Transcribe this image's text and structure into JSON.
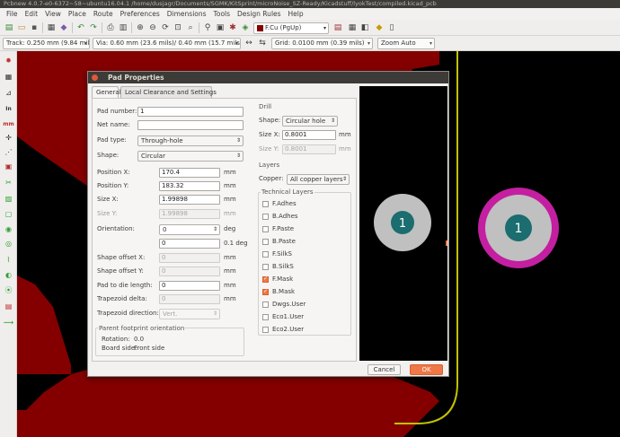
{
  "window": {
    "title": "Pcbnew 4.0.7-e0-6372~58~ubuntu16.04.1 /home/dusjagr/Documents/SGMK/KitSprint/microNoise_SZ-Ready/Kicadstuff/lyokTest/compiled.kicad_pcb"
  },
  "menubar": {
    "items": [
      "File",
      "Edit",
      "View",
      "Place",
      "Route",
      "Preferences",
      "Dimensions",
      "Tools",
      "Design Rules",
      "Help"
    ]
  },
  "toolbar": {
    "layer": "F.Cu (PgUp)",
    "track": "Track: 0.250 mm (9.84 mils) *",
    "via": "Via: 0.60 mm (23.6 mils)/ 0.40 mm (15.7 mils) *",
    "grid": "Grid: 0.0100 mm (0.39 mils)",
    "zoom": "Zoom Auto"
  },
  "dialog": {
    "title": "Pad Properties",
    "tabs": [
      "General",
      "Local Clearance and Settings"
    ],
    "general": {
      "pad_number_label": "Pad number:",
      "pad_number": "1",
      "net_name_label": "Net name:",
      "net_name": "",
      "pad_type_label": "Pad type:",
      "pad_type": "Through-hole",
      "shape_label": "Shape:",
      "shape": "Circular",
      "position_x_label": "Position X:",
      "position_x": "170.4",
      "position_y_label": "Position Y:",
      "position_y": "183.32",
      "size_x_label": "Size X:",
      "size_x": "1.99898",
      "size_y_label": "Size Y:",
      "size_y": "1.99898",
      "orientation_label": "Orientation:",
      "orientation": "0",
      "orientation_unit": "deg",
      "orientation_fine": "0",
      "orientation_fine_unit": "0.1 deg",
      "shape_offset_x_label": "Shape offset X:",
      "shape_offset_x": "0",
      "shape_offset_y_label": "Shape offset Y:",
      "shape_offset_y": "0",
      "pad_to_die_label": "Pad to die length:",
      "pad_to_die": "0",
      "trapezoid_delta_label": "Trapezoid delta:",
      "trapezoid_delta": "0",
      "trapezoid_dir_label": "Trapezoid direction:",
      "trapezoid_dir": "Vert.",
      "unit_mm": "mm",
      "parent_header": "Parent footprint orientation",
      "rotation_label": "Rotation:",
      "rotation": "0.0",
      "board_side_label": "Board side:",
      "board_side": "Front side"
    },
    "drill": {
      "header": "Drill",
      "shape_label": "Shape:",
      "shape": "Circular hole",
      "size_x_label": "Size X:",
      "size_x": "0.8001",
      "size_y_label": "Size Y:",
      "size_y": "0.8001",
      "unit_mm": "mm"
    },
    "layers": {
      "header": "Layers",
      "copper_label": "Copper:",
      "copper": "All copper layers",
      "technical_header": "Technical Layers",
      "items": [
        {
          "name": "F.Adhes",
          "checked": false
        },
        {
          "name": "B.Adhes",
          "checked": false
        },
        {
          "name": "F.Paste",
          "checked": false
        },
        {
          "name": "B.Paste",
          "checked": false
        },
        {
          "name": "F.SilkS",
          "checked": false
        },
        {
          "name": "B.SilkS",
          "checked": false
        },
        {
          "name": "F.Mask",
          "checked": true
        },
        {
          "name": "B.Mask",
          "checked": true
        },
        {
          "name": "Dwgs.User",
          "checked": false
        },
        {
          "name": "Eco1.User",
          "checked": false
        },
        {
          "name": "Eco2.User",
          "checked": false
        }
      ]
    },
    "preview_pad_number": "1",
    "cancel_label": "Cancel",
    "ok_label": "OK"
  },
  "board": {
    "pad_number": "1"
  },
  "colors": {
    "copper_red": "#840000",
    "board_outline": "#c2c200",
    "pad_gray": "#c0c0c0",
    "pad_hole": "#1b6d6f",
    "mask_magenta": "#c31fa0",
    "accent_orange": "#f07746"
  }
}
